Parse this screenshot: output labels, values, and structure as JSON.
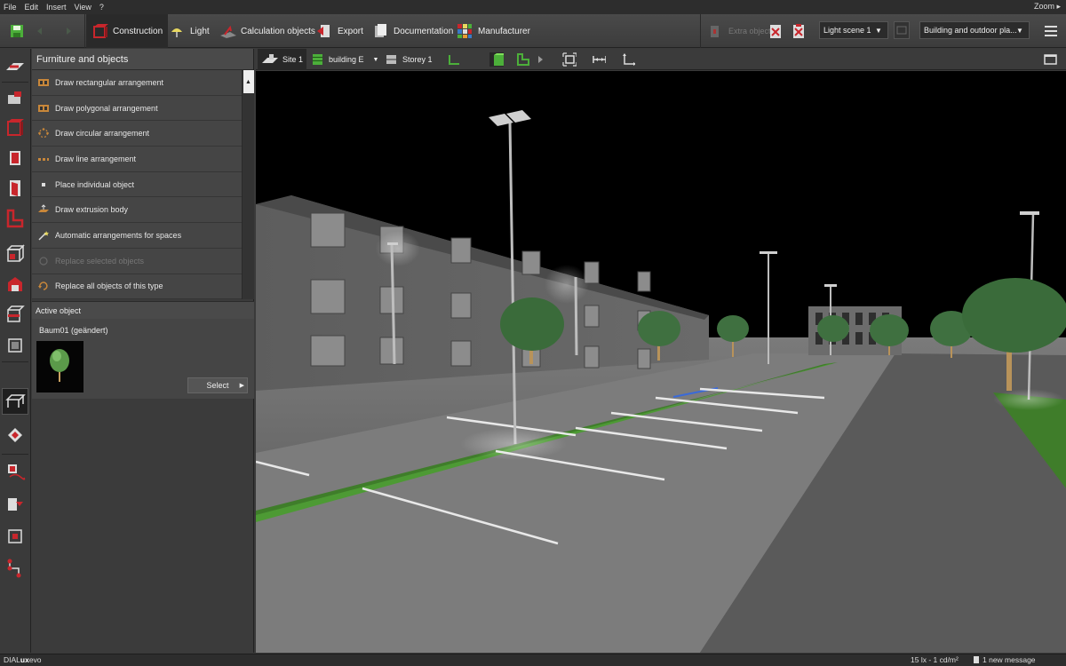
{
  "menu": {
    "items": [
      "File",
      "Edit",
      "Insert",
      "View",
      "?"
    ],
    "zoom_label": "Zoom"
  },
  "toolbar": {
    "modes": [
      {
        "label": "Construction",
        "icon": "construction-icon",
        "active": true
      },
      {
        "label": "Light",
        "icon": "lamp-icon",
        "active": false
      },
      {
        "label": "Calculation objects",
        "icon": "calculation-icon",
        "active": false
      },
      {
        "label": "Export",
        "icon": "export-icon",
        "active": false
      },
      {
        "label": "Documentation",
        "icon": "documentation-icon",
        "active": false
      },
      {
        "label": "Manufacturer",
        "icon": "manufacturer-icon",
        "active": false
      }
    ],
    "disabled_action": "Extra object",
    "light_scene": "Light scene 1",
    "view_scope": "Building and outdoor pla..."
  },
  "panel": {
    "title": "Furniture and objects",
    "items": [
      {
        "label": "Draw rectangular arrangement",
        "icon": "rect-arrangement-icon",
        "enabled": true
      },
      {
        "label": "Draw polygonal arrangement",
        "icon": "polygon-arrangement-icon",
        "enabled": true
      },
      {
        "label": "Draw circular arrangement",
        "icon": "circular-arrangement-icon",
        "enabled": true
      },
      {
        "label": "Draw line arrangement",
        "icon": "line-arrangement-icon",
        "enabled": true
      },
      {
        "label": "Place individual object",
        "icon": "single-object-icon",
        "enabled": true
      },
      {
        "label": "Draw extrusion body",
        "icon": "extrusion-icon",
        "enabled": true
      },
      {
        "label": "Automatic arrangements for spaces",
        "icon": "magic-wand-icon",
        "enabled": true
      },
      {
        "label": "Replace selected objects",
        "icon": "replace-selected-icon",
        "enabled": false
      },
      {
        "label": "Replace all objects of this type",
        "icon": "replace-all-icon",
        "enabled": true
      }
    ],
    "active_object": {
      "header": "Active object",
      "name": "Baum01 (geändert)",
      "select_label": "Select"
    }
  },
  "viewbar": {
    "site": "Site 1",
    "building": "building E",
    "storey": "Storey 1"
  },
  "status": {
    "brand_prefix": "DIAL",
    "brand_bold": "ux",
    "brand_suffix": "evo",
    "lux": "15 lx - 1 cd/m²",
    "messages": "1 new message"
  },
  "colors": {
    "accent_red": "#c8262c",
    "accent_green": "#4caf3a",
    "grass": "#3f7d2a",
    "tree": "#3a6b3a"
  }
}
